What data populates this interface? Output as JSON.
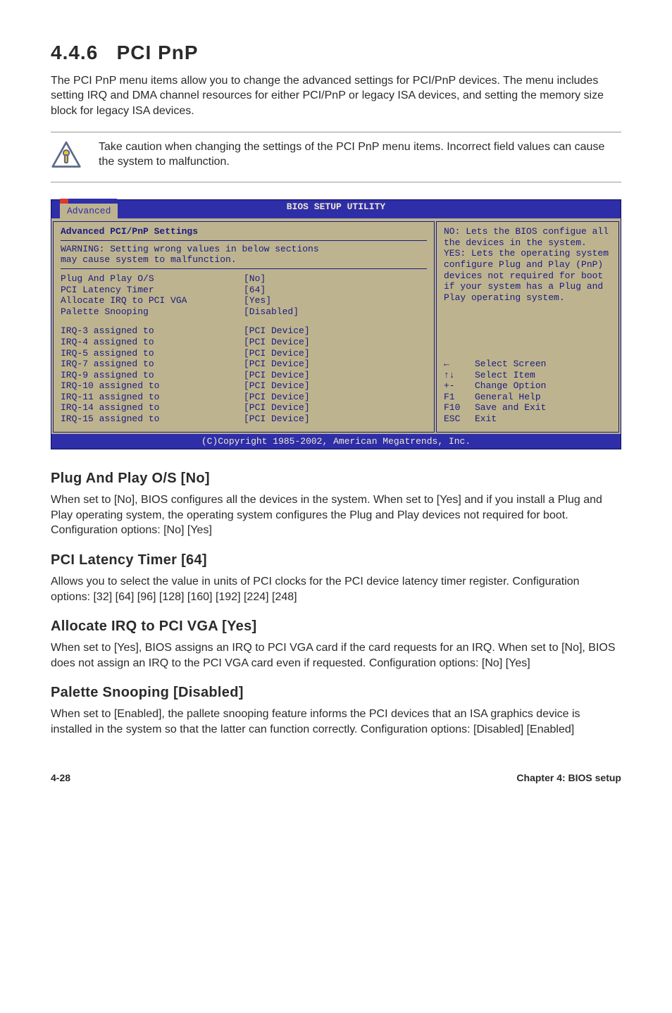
{
  "section": {
    "number": "4.4.6",
    "title": "PCI PnP"
  },
  "intro": "The PCI PnP menu items allow you to change the advanced settings for PCI/PnP devices. The menu includes setting IRQ and DMA channel resources for either PCI/PnP or legacy ISA devices, and setting the memory size block for legacy ISA devices.",
  "callout": "Take caution when changing the settings of the PCI PnP menu items. Incorrect field values can cause the system to malfunction.",
  "bios": {
    "utility_title": "BIOS SETUP UTILITY",
    "tab": "Advanced",
    "panel_title": "Advanced PCI/PnP Settings",
    "warning_l1": "WARNING: Setting wrong values in below sections",
    "warning_l2": "         may cause system to malfunction.",
    "rows_a": [
      {
        "label": "Plug And Play O/S",
        "value": "[No]"
      },
      {
        "label": "PCI Latency Timer",
        "value": "[64]"
      },
      {
        "label": "Allocate IRQ to PCI VGA",
        "value": "[Yes]"
      },
      {
        "label": "Palette Snooping",
        "value": "[Disabled]"
      }
    ],
    "rows_b": [
      {
        "label": "IRQ-3 assigned to",
        "value": "[PCI Device]"
      },
      {
        "label": "IRQ-4 assigned to",
        "value": "[PCI Device]"
      },
      {
        "label": "IRQ-5 assigned to",
        "value": "[PCI Device]"
      },
      {
        "label": "IRQ-7 assigned to",
        "value": "[PCI Device]"
      },
      {
        "label": "IRQ-9 assigned to",
        "value": "[PCI Device]"
      },
      {
        "label": "IRQ-10 assigned to",
        "value": "[PCI Device]"
      },
      {
        "label": "IRQ-11 assigned to",
        "value": "[PCI Device]"
      },
      {
        "label": "IRQ-14 assigned to",
        "value": "[PCI Device]"
      },
      {
        "label": "IRQ-15 assigned to",
        "value": "[PCI Device]"
      }
    ],
    "help": "NO: Lets the BIOS configue all the devices in the system. YES: Lets the operating system configure Plug and Play (PnP) devices not required for boot if your system has a Plug and Play operating system.",
    "nav": [
      {
        "k": "←",
        "t": "Select Screen"
      },
      {
        "k": "↑↓",
        "t": "Select Item"
      },
      {
        "k": "+-",
        "t": "Change Option"
      },
      {
        "k": "F1",
        "t": "General Help"
      },
      {
        "k": "F10",
        "t": "Save and Exit"
      },
      {
        "k": "ESC",
        "t": "Exit"
      }
    ],
    "footer": "(C)Copyright 1985-2002, American Megatrends, Inc."
  },
  "subsections": [
    {
      "heading": "Plug And Play O/S [No]",
      "body": "When set to [No], BIOS configures all the devices in the system. When set to [Yes] and if you install a Plug and Play operating system, the operating system configures the Plug and Play devices not required for boot. Configuration options: [No] [Yes]"
    },
    {
      "heading": "PCI Latency Timer [64]",
      "body": "Allows you to select the value in units of PCI clocks for the PCI device latency timer register. Configuration options: [32] [64] [96] [128] [160] [192] [224] [248]"
    },
    {
      "heading": "Allocate IRQ to PCI VGA [Yes]",
      "body": "When set to [Yes], BIOS assigns an IRQ to PCI VGA card if the card requests for an IRQ. When set to [No], BIOS does not assign an IRQ to the PCI VGA card even if requested. Configuration options: [No] [Yes]"
    },
    {
      "heading": "Palette Snooping [Disabled]",
      "body": "When set to [Enabled], the pallete snooping feature informs the PCI devices that an ISA graphics device is installed in the system so that the latter can function correctly. Configuration options: [Disabled] [Enabled]"
    }
  ],
  "footer": {
    "left": "4-28",
    "right": "Chapter 4: BIOS setup"
  }
}
